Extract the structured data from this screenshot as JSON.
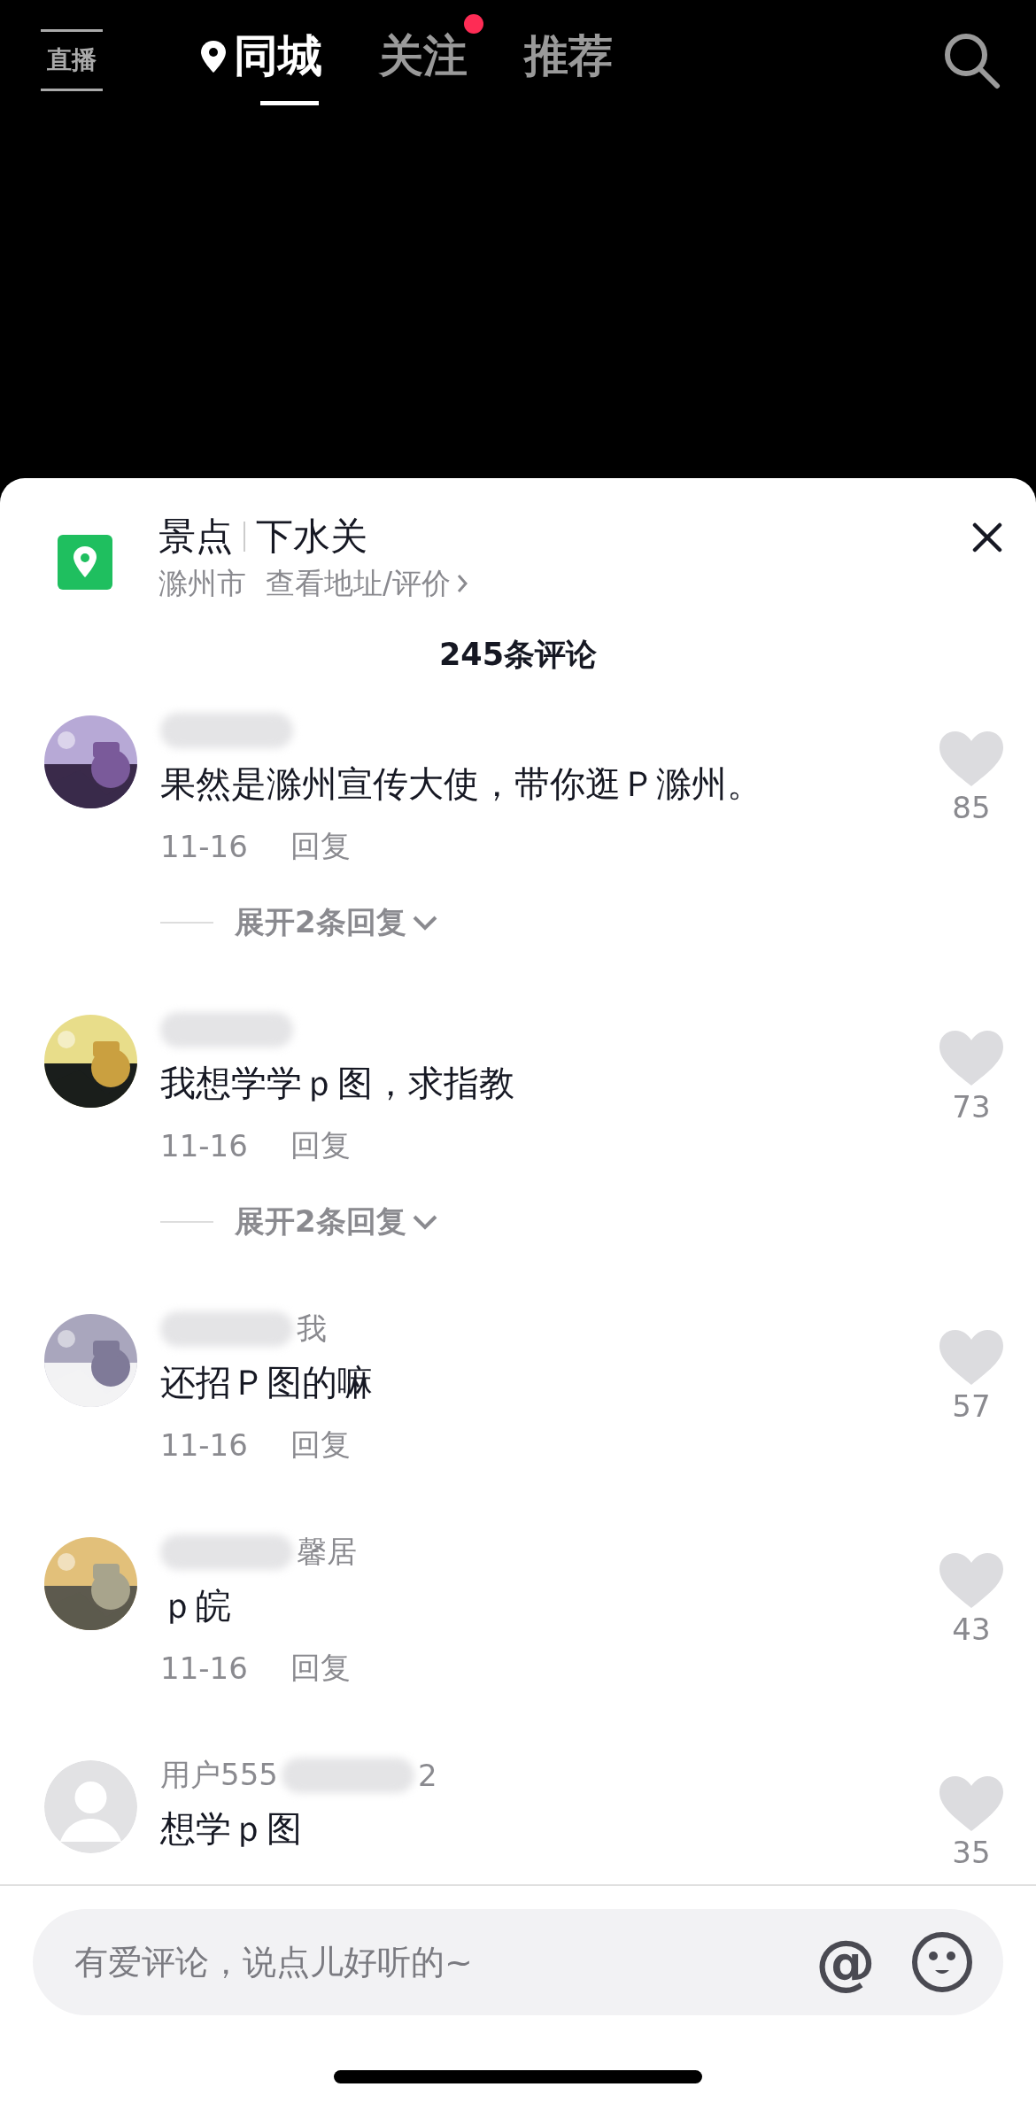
{
  "top_nav": {
    "live_label": "直播",
    "tabs": [
      {
        "label": "同城",
        "selected": true,
        "kind": "location",
        "badge": false
      },
      {
        "label": "关注",
        "selected": false,
        "kind": "plain",
        "badge": true
      },
      {
        "label": "推荐",
        "selected": false,
        "kind": "plain",
        "badge": false
      }
    ]
  },
  "place": {
    "category": "景点",
    "name": "下水关",
    "city": "滁州市",
    "link": "查看地址/评价"
  },
  "comment_count": "245条评论",
  "comments": [
    {
      "avatar": {
        "kind": "picture"
      },
      "name": [
        {
          "kind": "blur"
        }
      ],
      "text": "果然是滁州宣传大使，带你逛Ｐ滁州。",
      "date": "11-16",
      "reply": "回复",
      "likes": "85",
      "liked": false,
      "expand": "展开2条回复"
    },
    {
      "avatar": {
        "kind": "picture"
      },
      "name": [
        {
          "kind": "blur"
        }
      ],
      "text": "我想学学ｐ图，求指教",
      "date": "11-16",
      "reply": "回复",
      "likes": "73",
      "liked": false,
      "expand": "展开2条回复"
    },
    {
      "avatar": {
        "kind": "picture"
      },
      "name": [
        {
          "kind": "blur"
        },
        {
          "kind": "text",
          "text": "我"
        }
      ],
      "text": "还招Ｐ图的嘛",
      "date": "11-16",
      "reply": "回复",
      "likes": "57",
      "liked": false
    },
    {
      "avatar": {
        "kind": "picture"
      },
      "name": [
        {
          "kind": "blur"
        },
        {
          "kind": "text",
          "text": "馨居"
        }
      ],
      "text": "ｐ皖",
      "date": "11-16",
      "reply": "回复",
      "likes": "43",
      "liked": false
    },
    {
      "avatar": {
        "kind": "default"
      },
      "name": [
        {
          "kind": "text",
          "text": "用户555"
        },
        {
          "kind": "blur"
        },
        {
          "kind": "text",
          "text": "2"
        }
      ],
      "text": "想学ｐ图",
      "likes": "35",
      "liked": false
    }
  ],
  "input": {
    "placeholder": "有爱评论，说点儿好听的~",
    "mention": "@"
  }
}
